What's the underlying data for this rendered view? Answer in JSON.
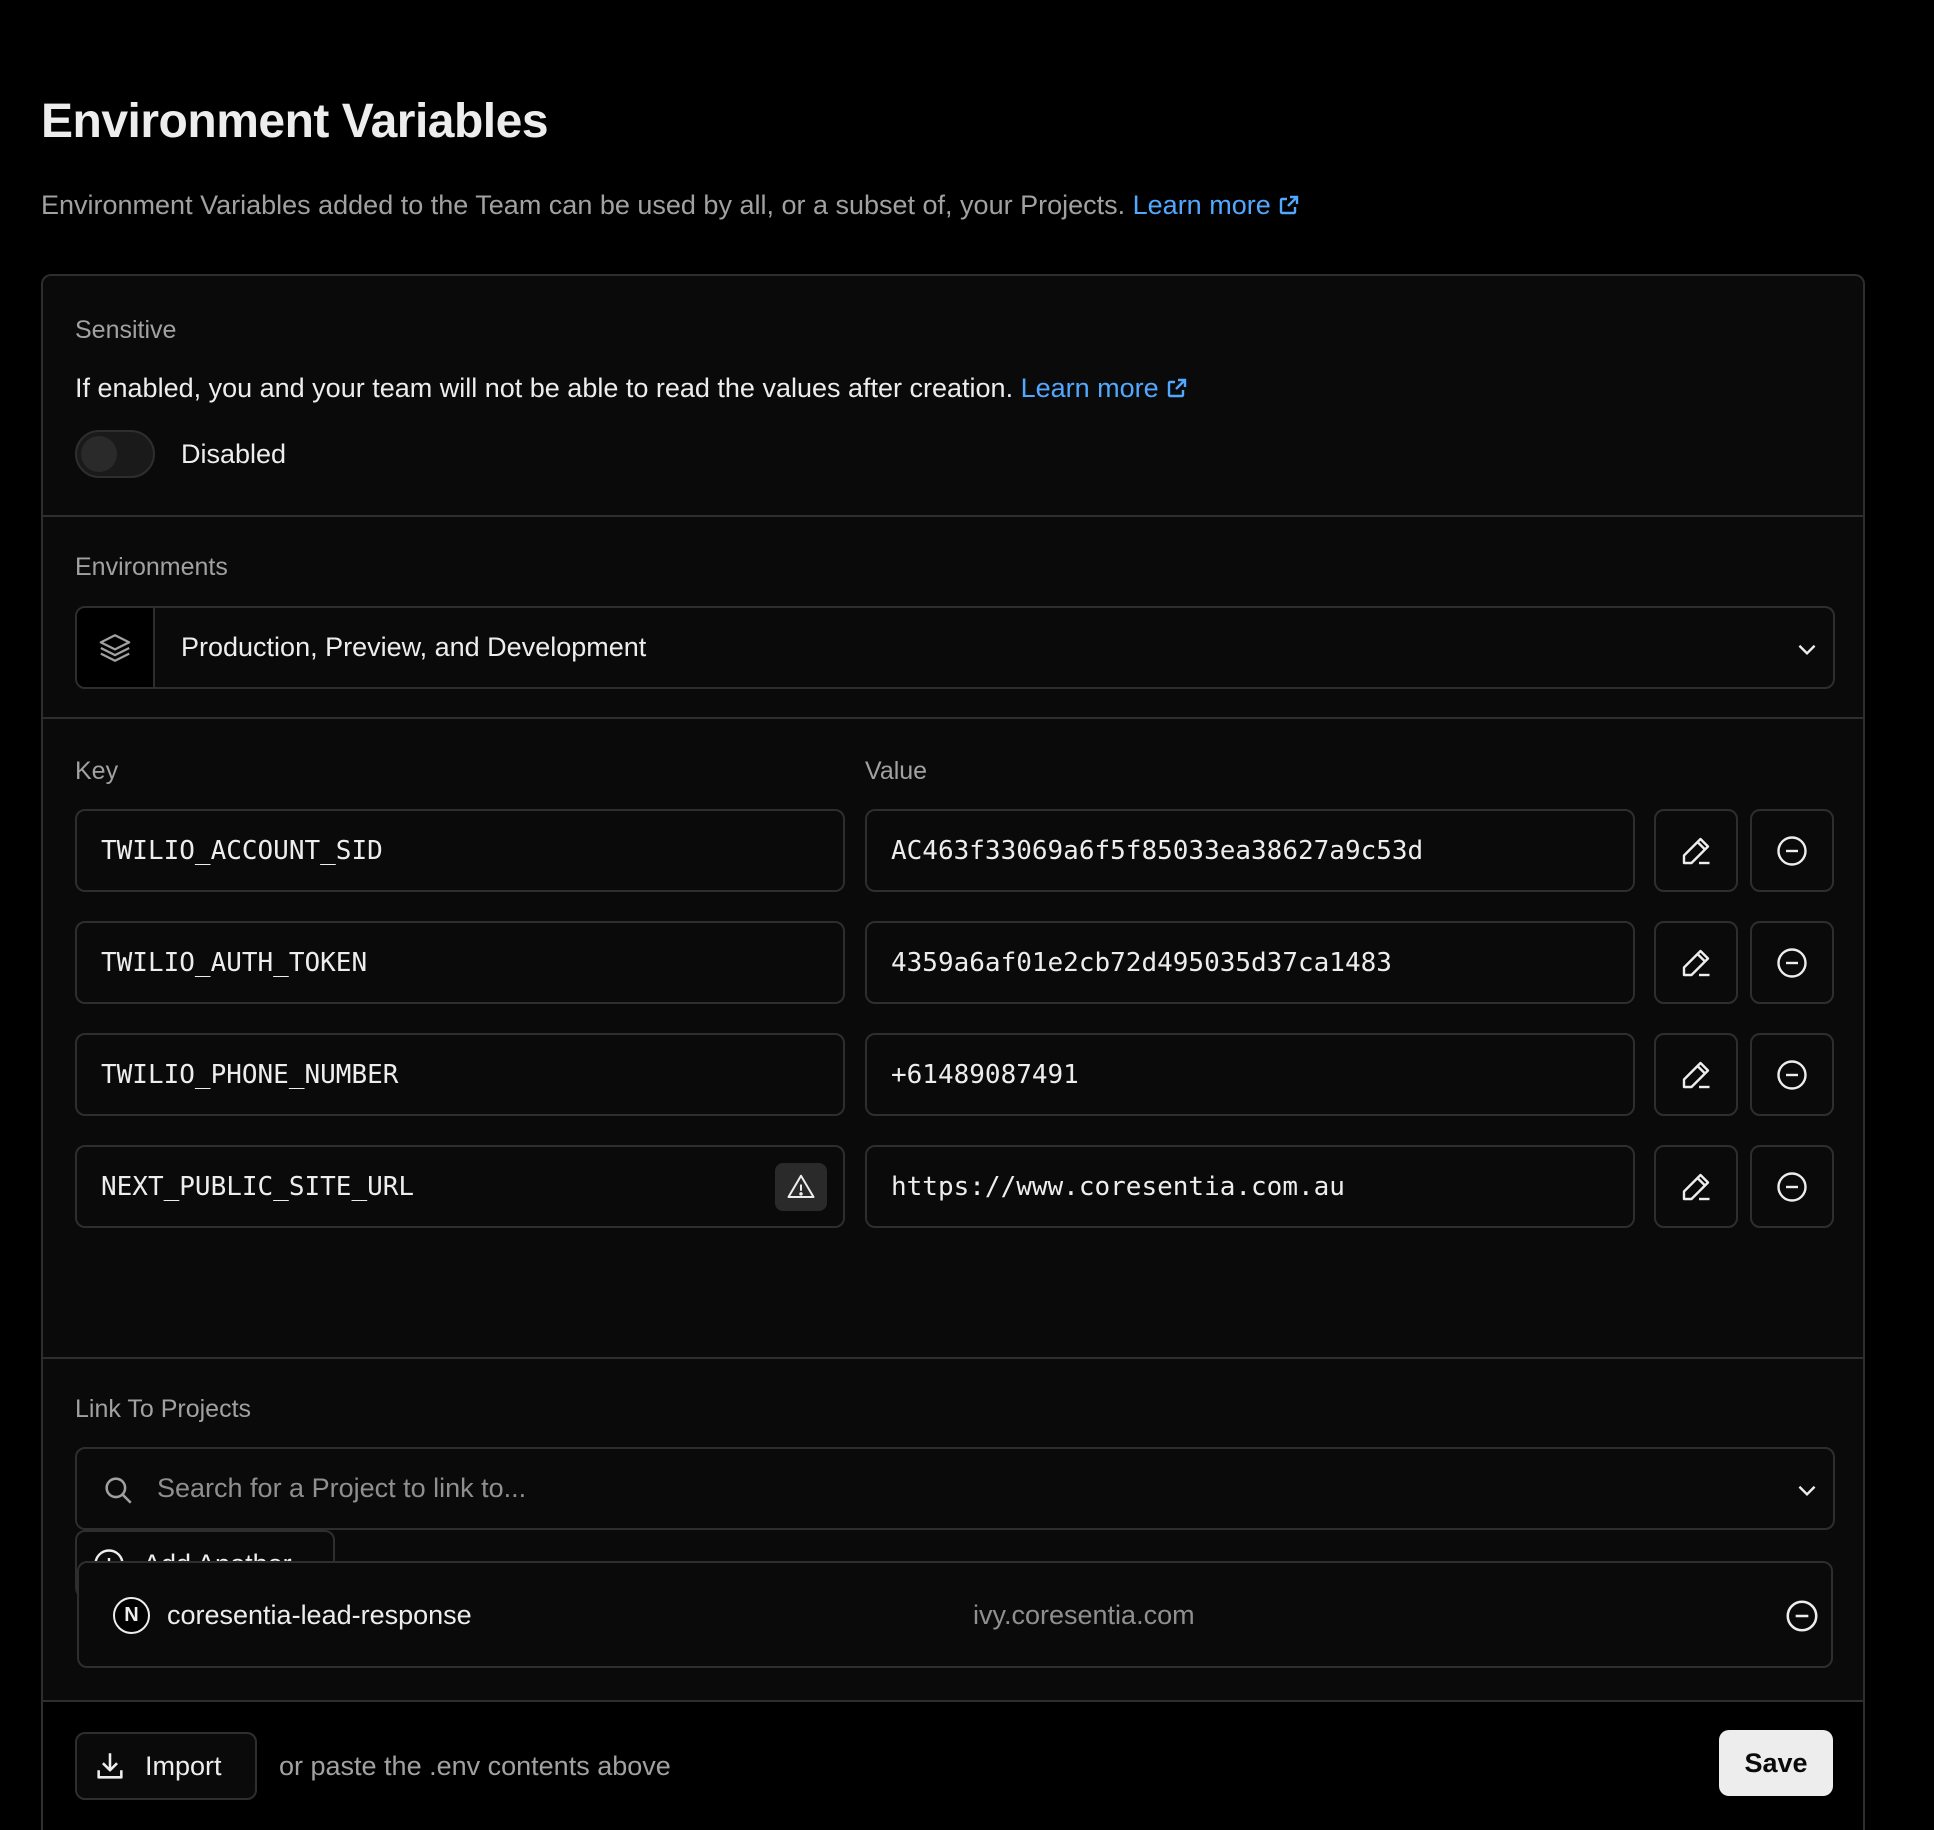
{
  "page": {
    "title": "Environment Variables",
    "subtitle": "Environment Variables added to the Team can be used by all, or a subset of, your Projects.",
    "learn_more": "Learn more"
  },
  "sensitive": {
    "label": "Sensitive",
    "description": "If enabled, you and your team will not be able to read the values after creation.",
    "learn_more": "Learn more",
    "toggle_state": "Disabled",
    "enabled": false
  },
  "environments": {
    "label": "Environments",
    "selected": "Production, Preview, and Development"
  },
  "variables": {
    "key_header": "Key",
    "value_header": "Value",
    "rows": [
      {
        "key": "TWILIO_ACCOUNT_SID",
        "value": "AC463f33069a6f5f85033ea38627a9c53d",
        "warning": false
      },
      {
        "key": "TWILIO_AUTH_TOKEN",
        "value": "4359a6af01e2cb72d495035d37ca1483",
        "warning": false
      },
      {
        "key": "TWILIO_PHONE_NUMBER",
        "value": "+61489087491",
        "warning": false
      },
      {
        "key": "NEXT_PUBLIC_SITE_URL",
        "value": "https://www.coresentia.com.au",
        "warning": true
      }
    ],
    "add_another": "Add Another"
  },
  "link_projects": {
    "label": "Link To Projects",
    "search_placeholder": "Search for a Project to link to...",
    "projects": [
      {
        "name": "coresentia-lead-response",
        "domain": "ivy.coresentia.com",
        "avatar": "N"
      }
    ]
  },
  "footer": {
    "import_label": "Import",
    "hint": "or paste the .env contents above",
    "save_label": "Save"
  },
  "colors": {
    "background": "#000000",
    "link": "#52a8ff",
    "border": "#2e2e2e",
    "save_bg": "#ededed"
  }
}
